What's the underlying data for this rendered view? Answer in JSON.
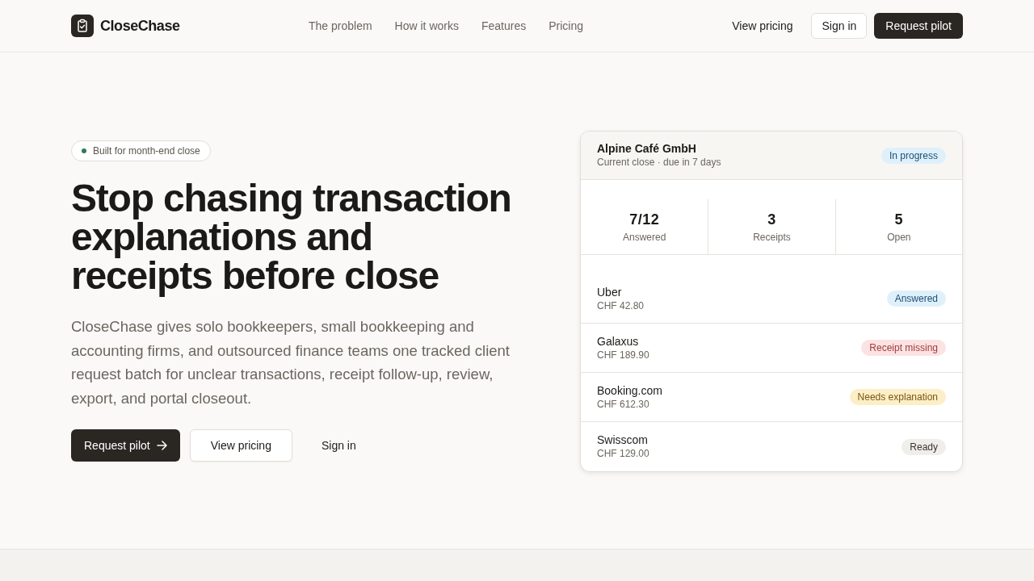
{
  "header": {
    "brand": "CloseChase",
    "nav": [
      "The problem",
      "How it works",
      "Features",
      "Pricing"
    ],
    "actions": [
      {
        "label": "View pricing",
        "kind": "link"
      },
      {
        "label": "Sign in",
        "kind": "outline"
      },
      {
        "label": "Request pilot",
        "kind": "primary"
      }
    ]
  },
  "hero": {
    "badge": "Built for month-end close",
    "headline": "Stop chasing transaction explanations and receipts before close",
    "description": "CloseChase gives solo bookkeepers, small bookkeeping and accounting firms, and outsourced finance teams one tracked client request batch for unclear transactions, receipt follow-up, review, export, and portal closeout.",
    "buttons": [
      {
        "label": "Request pilot",
        "kind": "primary",
        "arrow": true
      },
      {
        "label": "View pricing",
        "kind": "outline",
        "arrow": false
      },
      {
        "label": "Sign in",
        "kind": "link",
        "arrow": false
      }
    ]
  },
  "close_card": {
    "client": "Alpine Café GmbH",
    "subtitle": "Current close · due in 7 days",
    "status": {
      "label": "In progress",
      "kind": "info"
    },
    "stats": [
      {
        "value": "7/12",
        "label": "Answered"
      },
      {
        "value": "3",
        "label": "Receipts"
      },
      {
        "value": "5",
        "label": "Open"
      }
    ],
    "transactions": [
      {
        "merchant": "Uber",
        "amount": "CHF 42.80",
        "status": {
          "label": "Answered",
          "kind": "info"
        }
      },
      {
        "merchant": "Galaxus",
        "amount": "CHF 189.90",
        "status": {
          "label": "Receipt missing",
          "kind": "danger"
        }
      },
      {
        "merchant": "Booking.com",
        "amount": "CHF 612.30",
        "status": {
          "label": "Needs explanation",
          "kind": "warning"
        }
      },
      {
        "merchant": "Swisscom",
        "amount": "CHF 129.00",
        "status": {
          "label": "Ready",
          "kind": "neutral"
        }
      }
    ]
  }
}
